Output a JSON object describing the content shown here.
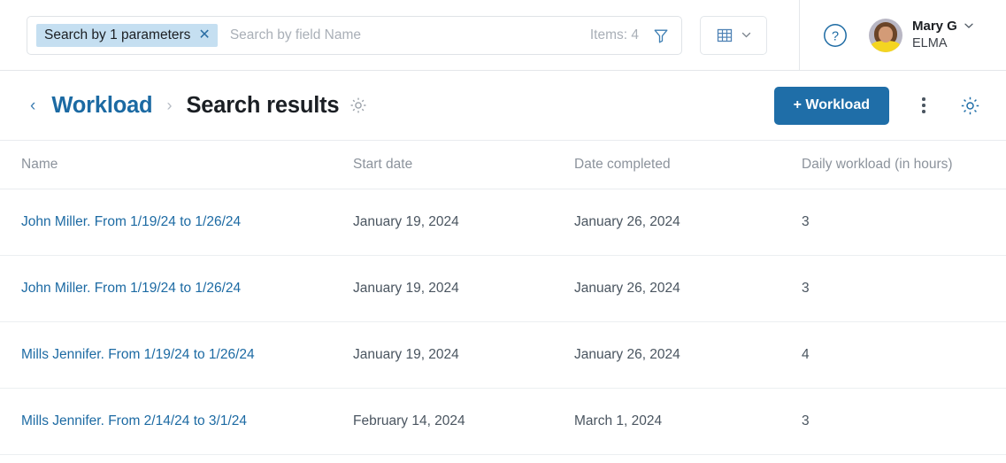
{
  "search": {
    "chip_label": "Search by 1 parameters",
    "chip_close_icon": "close-icon",
    "placeholder": "Search by field Name",
    "value": "",
    "items_count_label": "Items: 4",
    "filter_icon": "funnel-icon",
    "view_icon": "table-grid-icon",
    "view_chevron_icon": "chevron-down-icon"
  },
  "user": {
    "help_icon": "question-circle-icon",
    "avatar_icon": "user-avatar",
    "name": "Mary G",
    "org": "ELMA",
    "chevron_icon": "chevron-down-icon"
  },
  "header": {
    "back_icon": "chevron-left-icon",
    "breadcrumb_parent": "Workload",
    "breadcrumb_separator": "›",
    "title": "Search results",
    "title_gear_icon": "gear-icon",
    "create_button": "+ Workload",
    "kebab_icon": "more-vertical-icon",
    "settings_icon": "gear-icon"
  },
  "colors": {
    "accent": "#1c6aa3",
    "primary_button": "#1f6ea8",
    "chip_background": "#c5dff1",
    "muted_text": "#8c939c",
    "body_text": "#4a5560"
  },
  "table": {
    "columns": [
      {
        "key": "name",
        "label": "Name"
      },
      {
        "key": "start",
        "label": "Start date"
      },
      {
        "key": "done",
        "label": "Date completed"
      },
      {
        "key": "load",
        "label": "Daily workload (in hours)"
      }
    ],
    "rows": [
      {
        "name": "John Miller. From 1/19/24 to 1/26/24",
        "start": "January 19, 2024",
        "done": "January 26, 2024",
        "load": "3"
      },
      {
        "name": "John Miller. From 1/19/24 to 1/26/24",
        "start": "January 19, 2024",
        "done": "January 26, 2024",
        "load": "3"
      },
      {
        "name": "Mills Jennifer. From 1/19/24 to 1/26/24",
        "start": "January 19, 2024",
        "done": "January 26, 2024",
        "load": "4"
      },
      {
        "name": "Mills Jennifer. From 2/14/24 to 3/1/24",
        "start": "February 14, 2024",
        "done": "March 1, 2024",
        "load": "3"
      }
    ]
  }
}
